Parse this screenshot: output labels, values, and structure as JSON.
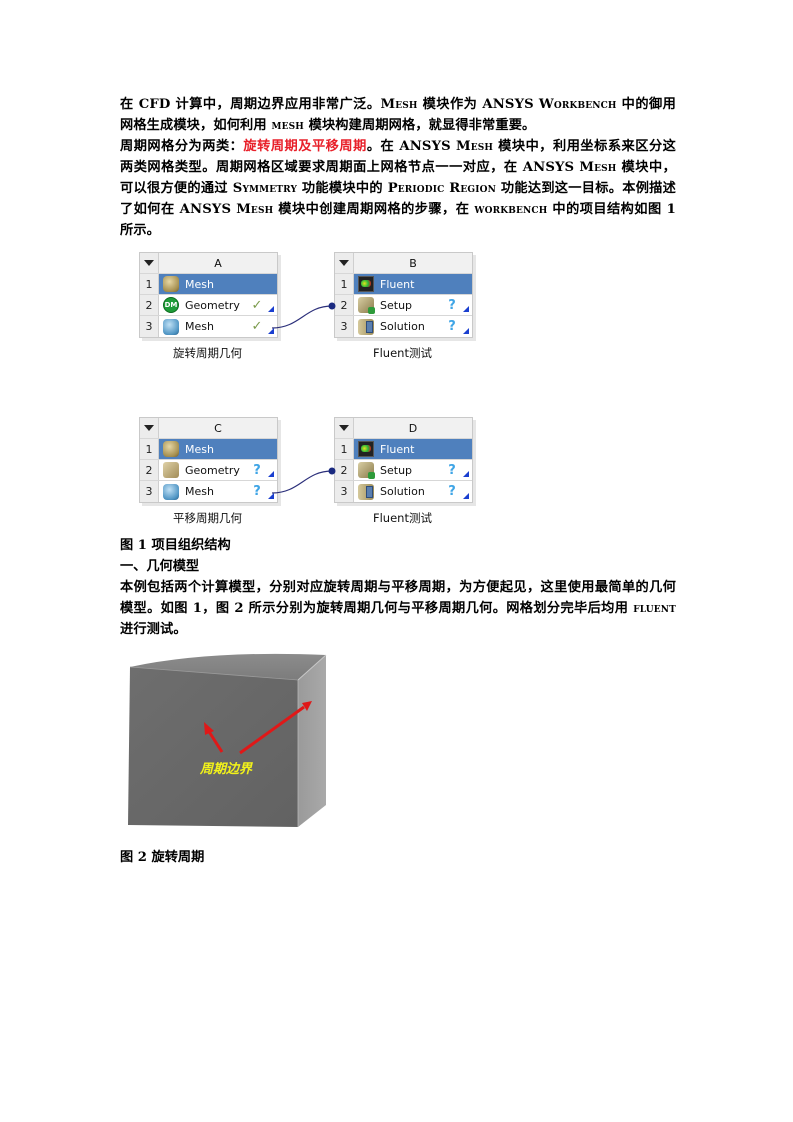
{
  "paragraphs": {
    "p1": {
      "t1": "在 CFD 计算中，周期边界应用非常广泛。",
      "t2": "Mesh",
      "t3": " 模块作为 ANSYS ",
      "t4": "Workbench",
      "t5": " 中的御用网格生成模块，如何利用 ",
      "t6": "mesh",
      "t7": " 模块构建周期网格，就显得非常重要。"
    },
    "p2": {
      "t1": "周期网格分为两类：",
      "highlight": "旋转周期及平移周期",
      "t2": "。在 ANSYS ",
      "t3": "Mesh",
      "t4": " 模块中，利用坐标系来区分这两类网格类型。周期网格区域要求周期面上网格节点一一对应，在 ANSYS ",
      "t5": "Mesh",
      "t6": " 模块中，可以很方便的通过 ",
      "t7": "Symmetry",
      "t8": " 功能模块中的 ",
      "t9": "Periodic Region",
      "t10": " 功能达到这一目标。本例描述了如何在 ANSYS ",
      "t11": "Mesh",
      "t12": " 模块中创建周期网格的步骤，在 ",
      "t13": "workbench",
      "t14": " 中的项目结构如图 1 所示。"
    },
    "p3": {
      "t1": "本例包括两个计算模型，分别对应旋转周期与平移周期，为方便起见，这里使用最简单的几何模型。如图 1，图 2 所示分别为旋转周期几何与平移周期几何。网格划分完毕后均用 ",
      "t2": "fluent",
      "t3": " 进行测试。"
    }
  },
  "highlight_color": "#e8202a",
  "systems": {
    "A": {
      "column": "A",
      "rows": [
        {
          "num": "1",
          "label": "Mesh",
          "icon": "mesh-gold-icon",
          "status": ""
        },
        {
          "num": "2",
          "label": "Geometry",
          "icon": "dm-icon",
          "icon_text": "DM",
          "status": "✓"
        },
        {
          "num": "3",
          "label": "Mesh",
          "icon": "mesh-blue-icon",
          "status": "✓"
        }
      ],
      "caption": "旋转周期几何"
    },
    "B": {
      "column": "B",
      "rows": [
        {
          "num": "1",
          "label": "Fluent",
          "icon": "fluent-icon",
          "status": ""
        },
        {
          "num": "2",
          "label": "Setup",
          "icon": "setup-icon",
          "status": "?"
        },
        {
          "num": "3",
          "label": "Solution",
          "icon": "solution-icon",
          "status": "?"
        }
      ],
      "caption": "Fluent测试"
    },
    "C": {
      "column": "C",
      "rows": [
        {
          "num": "1",
          "label": "Mesh",
          "icon": "mesh-gold-icon",
          "status": ""
        },
        {
          "num": "2",
          "label": "Geometry",
          "icon": "geometry-icon",
          "status": "?"
        },
        {
          "num": "3",
          "label": "Mesh",
          "icon": "mesh-blue-icon",
          "status": "?"
        }
      ],
      "caption": "平移周期几何"
    },
    "D": {
      "column": "D",
      "rows": [
        {
          "num": "1",
          "label": "Fluent",
          "icon": "fluent-icon",
          "status": ""
        },
        {
          "num": "2",
          "label": "Setup",
          "icon": "setup-icon",
          "status": "?"
        },
        {
          "num": "3",
          "label": "Solution",
          "icon": "solution-icon",
          "status": "?"
        }
      ],
      "caption": "Fluent测试"
    }
  },
  "captions": {
    "fig1": "图  1  项目组织结构",
    "section1": "一、几何模型",
    "fig2": "图  2 旋转周期",
    "fig2_label": "周期边界"
  },
  "colors": {
    "title_row": "#4f80bd",
    "connector": "#2b2f7a",
    "arrow": "#e01818",
    "label_yellow": "#f2f21a"
  }
}
